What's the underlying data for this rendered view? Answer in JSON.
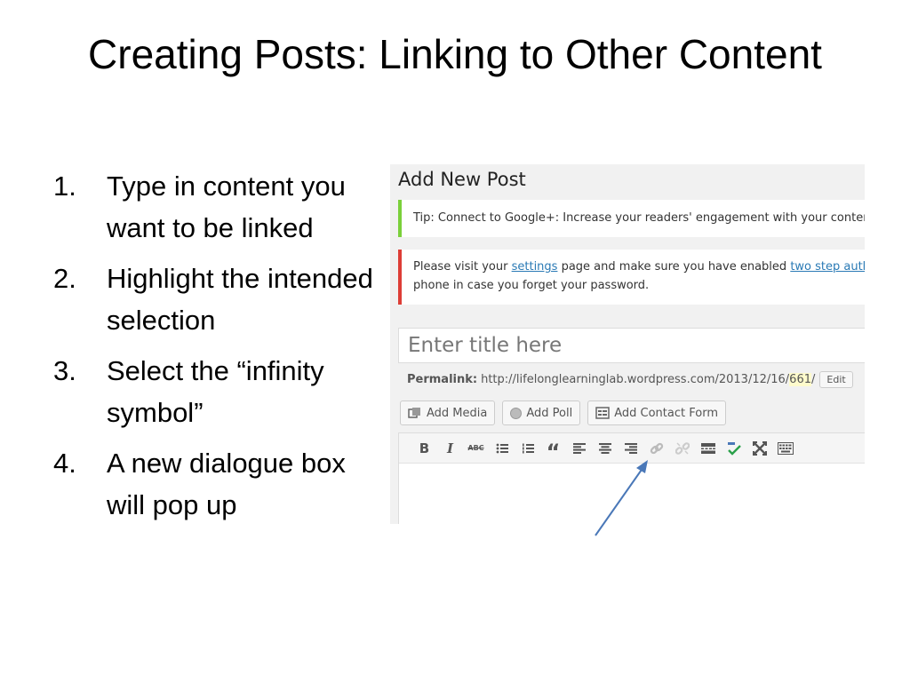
{
  "slide": {
    "title": "Creating Posts: Linking to Other Content",
    "steps": [
      {
        "num": "1.",
        "text": "Type in content you want to be linked"
      },
      {
        "num": "2.",
        "text": "Highlight the intended selection"
      },
      {
        "num": "3.",
        "text": "Select the “infinity symbol”"
      },
      {
        "num": "4.",
        "text": "A new dialogue box will pop up"
      }
    ]
  },
  "wp": {
    "heading": "Add New Post",
    "tip_notice": "Tip: Connect to Google+: Increase your readers' engagement with your content b",
    "warning": {
      "before": "Please visit your ",
      "settings_link": "settings",
      "middle": " page and make sure you have enabled ",
      "two_step_link": "two step auther",
      "line2": "phone in case you forget your password."
    },
    "title_placeholder": "Enter title here",
    "permalink": {
      "label": "Permalink:",
      "url_base": "http://lifelonglearninglab.wordpress.com/2013/12/16/",
      "slug": "661",
      "trail": "/",
      "edit_label": "Edit"
    },
    "media_buttons": {
      "add_media": "Add Media",
      "add_poll": "Add Poll",
      "add_contact_form": "Add Contact Form"
    },
    "toolbar": {
      "bold": "B",
      "italic": "I",
      "strike": "ABC",
      "quote": "“"
    }
  },
  "colors": {
    "tip_border": "#7ad03a",
    "warning_border": "#dd3d36",
    "link": "#2a7ab5",
    "arrow": "#4a78b8"
  }
}
